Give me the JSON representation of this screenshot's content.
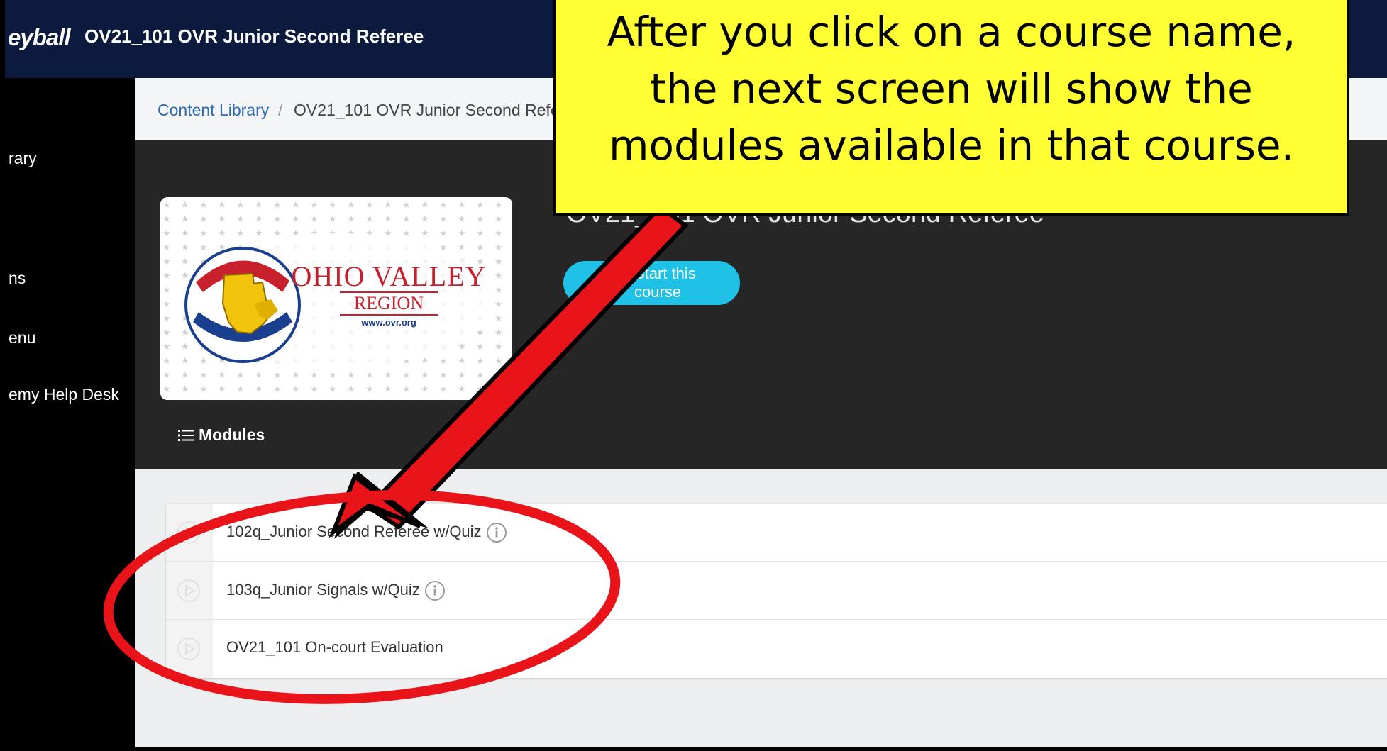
{
  "header": {
    "brand": "eyball",
    "course_title": "OV21_101 OVR Junior Second Referee"
  },
  "sidebar": {
    "items": [
      {
        "label": "rary"
      },
      {
        "label": "ns"
      },
      {
        "label": "enu"
      },
      {
        "label": "emy Help Desk"
      }
    ]
  },
  "breadcrumb": {
    "link": "Content Library",
    "separator": "/",
    "current": "OV21_101 OVR Junior Second Refer"
  },
  "hero": {
    "title": "OV21_101 OVR Junior Second Referee",
    "start_button": "Start this course",
    "modules_tab": "Modules",
    "thumbnail": {
      "line1": "OHIO VALLEY",
      "line2": "REGION",
      "line3": "www.ovr.org"
    }
  },
  "modules": [
    {
      "name": "102q_Junior Second Referee w/Quiz",
      "has_info": true
    },
    {
      "name": "103q_Junior Signals w/Quiz",
      "has_info": true
    },
    {
      "name": "OV21_101 On-court Evaluation",
      "has_info": false
    }
  ],
  "annotation": {
    "callout_text": "After you click on a course name, the next screen will show the modules available in that course."
  },
  "colors": {
    "topbar": "#0c1a3e",
    "accent": "#1fc2e6",
    "link": "#2d6bb5",
    "callout": "#ffff33",
    "arrow": "#e8141a"
  }
}
